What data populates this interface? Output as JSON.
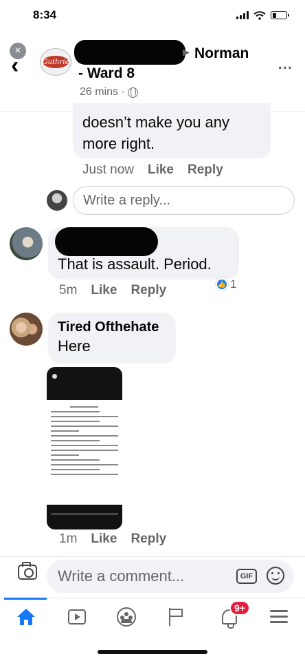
{
  "status_bar": {
    "time": "8:34"
  },
  "header": {
    "group_name": "Norman",
    "group_subtitle": "- Ward 8",
    "post_time": "26 mins ·",
    "more_label": "...",
    "close_label": "×",
    "back_label": "‹",
    "logo_text": "Guthrie"
  },
  "thread": {
    "reply_bubble": {
      "text": "doesn’t make you any more right.",
      "time": "Just now",
      "like_label": "Like",
      "reply_label": "Reply"
    },
    "reply_input": {
      "placeholder": "Write a reply..."
    },
    "comment_1": {
      "text": "That is assault. Period.",
      "time": "5m",
      "like_label": "Like",
      "reply_label": "Reply",
      "reaction_count": "1"
    },
    "comment_2": {
      "author": "Tired Ofthehate",
      "text": "Here",
      "time": "1m",
      "like_label": "Like",
      "reply_label": "Reply"
    }
  },
  "composer": {
    "placeholder": "Write a comment...",
    "gif_label": "GIF"
  },
  "tab_bar": {
    "notification_badge": "9+",
    "active_tab": "home"
  },
  "colors": {
    "accent": "#1877f2",
    "bubble": "#f0f2f5",
    "badge": "#e41e3f",
    "secondary_text": "#65676b"
  }
}
